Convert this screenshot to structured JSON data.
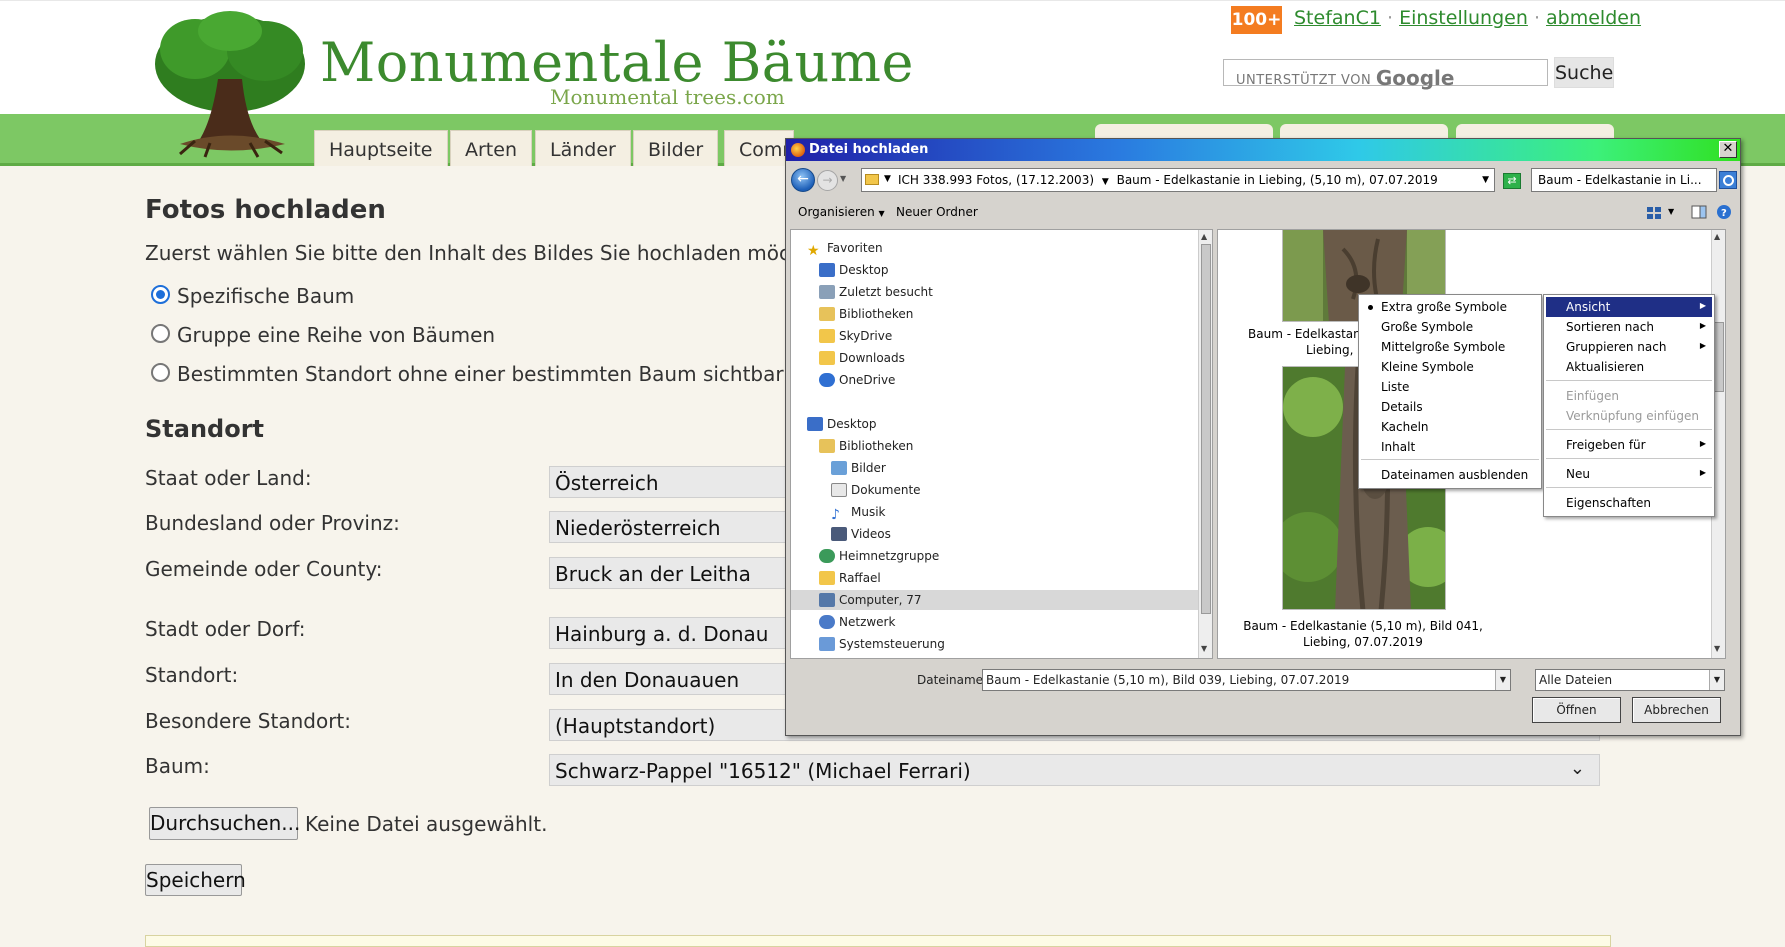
{
  "header": {
    "site_title": "Monumentale Bäume",
    "site_subtitle": "Monumental trees.com",
    "badge": "100+",
    "user_link": "StefanC1",
    "settings_link": "Einstellungen",
    "logout_link": "abmelden",
    "separator": "·",
    "search_placeholder_prefix": "UNTERSTÜTZT VON",
    "search_placeholder_brand": "Google",
    "search_button": "Suche"
  },
  "nav": {
    "tabs": [
      "Hauptseite",
      "Arten",
      "Länder",
      "Bilder",
      "Comm"
    ]
  },
  "form": {
    "title": "Fotos hochladen",
    "intro": "Zuerst wählen Sie bitte den Inhalt des Bildes Sie hochladen möchten:",
    "radios": [
      {
        "label": "Spezifische Baum",
        "checked": true
      },
      {
        "label": "Gruppe eine Reihe von Bäumen",
        "checked": false
      },
      {
        "label": "Bestimmten Standort ohne einer bestimmten Baum sichtbar (zB. ein S",
        "checked": false
      }
    ],
    "location_heading": "Standort",
    "fields": [
      {
        "label": "Staat oder Land:",
        "value": "Österreich"
      },
      {
        "label": "Bundesland oder Provinz:",
        "value": "Niederösterreich"
      },
      {
        "label": "Gemeinde oder County:",
        "value": "Bruck an der Leitha"
      },
      {
        "label": "Stadt oder Dorf:",
        "value": "Hainburg a. d. Donau"
      },
      {
        "label": "Standort:",
        "value": "In den Donauauen"
      },
      {
        "label": "Besondere Standort:",
        "value": "(Hauptstandort)"
      },
      {
        "label": "Baum:",
        "value": "Schwarz-Pappel \"16512\" (Michael Ferrari)"
      }
    ],
    "browse_button": "Durchsuchen...",
    "no_file": "Keine Datei ausgewählt.",
    "save_button": "Speichern"
  },
  "dialog": {
    "title": "Datei hochladen",
    "breadcrumb": [
      "ICH 338.993 Fotos, (17.12.2003)",
      "Baum - Edelkastanie in Liebing, (5,10 m), 07.07.2019"
    ],
    "search_value": "Baum - Edelkastanie in Li...",
    "organize": "Organisieren",
    "new_folder": "Neuer Ordner",
    "nav_items": [
      {
        "label": "Favoriten",
        "icon": "star-icon"
      },
      {
        "label": "Desktop",
        "icon": "desktop-icon"
      },
      {
        "label": "Zuletzt besucht",
        "icon": "recent-places-icon"
      },
      {
        "label": "Bibliotheken",
        "icon": "library-icon"
      },
      {
        "label": "SkyDrive",
        "icon": "folder-icon"
      },
      {
        "label": "Downloads",
        "icon": "folder-icon"
      },
      {
        "label": "OneDrive",
        "icon": "cloud-icon"
      },
      {
        "label": "Desktop",
        "icon": "desktop-icon"
      },
      {
        "label": "Bibliotheken",
        "icon": "library-icon"
      },
      {
        "label": "Bilder",
        "icon": "pictures-icon"
      },
      {
        "label": "Dokumente",
        "icon": "documents-icon"
      },
      {
        "label": "Musik",
        "icon": "music-icon"
      },
      {
        "label": "Videos",
        "icon": "videos-icon"
      },
      {
        "label": "Heimnetzgruppe",
        "icon": "homegroup-icon"
      },
      {
        "label": "Raffael",
        "icon": "user-folder-icon"
      },
      {
        "label": "Computer, 77",
        "icon": "computer-icon"
      },
      {
        "label": "Netzwerk",
        "icon": "network-icon"
      },
      {
        "label": "Systemsteuerung",
        "icon": "control-panel-icon"
      }
    ],
    "files": [
      {
        "caption1": "Baum - Edelkastan",
        "caption2": "Liebing,"
      },
      {
        "caption1": "Baum - Edelkastanie (5,10 m), Bild 041,",
        "caption2": "Liebing, 07.07.2019"
      }
    ],
    "filename_label": "Dateiname:",
    "filename_value": "Baum - Edelkastanie (5,10 m), Bild 039, Liebing, 07.07.2019",
    "filetype_value": "Alle Dateien",
    "open_button": "Öffnen",
    "cancel_button": "Abbrechen"
  },
  "view_menu": {
    "items": [
      "Extra große Symbole",
      "Große Symbole",
      "Mittelgroße Symbole",
      "Kleine Symbole",
      "Liste",
      "Details",
      "Kacheln",
      "Inhalt"
    ],
    "selected_index": 0,
    "extra": "Dateinamen ausblenden"
  },
  "context_menu": {
    "items": [
      {
        "label": "Ansicht",
        "submenu": true,
        "highlighted": true
      },
      {
        "label": "Sortieren nach",
        "submenu": true
      },
      {
        "label": "Gruppieren nach",
        "submenu": true
      },
      {
        "label": "Aktualisieren"
      },
      {
        "label": "Einfügen",
        "disabled": true
      },
      {
        "label": "Verknüpfung einfügen",
        "disabled": true
      },
      {
        "label": "Freigeben für",
        "submenu": true
      },
      {
        "label": "Neu",
        "submenu": true
      },
      {
        "label": "Eigenschaften"
      }
    ]
  }
}
